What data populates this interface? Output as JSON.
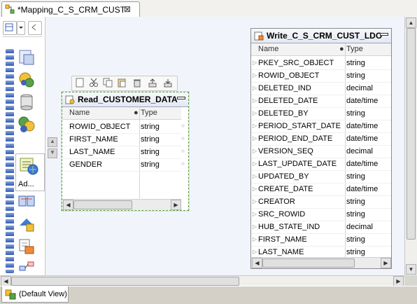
{
  "editor_tab": {
    "title": "*Mapping_C_S_CRM_CUST",
    "close_glyph": "⊠",
    "icon": "mapping-icon"
  },
  "palette": {
    "selected_label": "Ad...",
    "items": [
      "source-icon",
      "transform-icon",
      "database-icon",
      "joiner-icon",
      "address-validator-icon",
      "router-icon",
      "lookup-icon",
      "write-icon",
      "link-icon"
    ],
    "up_glyph": "▲",
    "down_glyph": "▼"
  },
  "float_toolbar": [
    "new-icon",
    "cut-icon",
    "copy-icon",
    "paste-icon",
    "delete-icon",
    "export-icon",
    "import-icon"
  ],
  "read_transform": {
    "title": "Read_CUSTOMER_DATA",
    "col_name": "Name",
    "col_type": "Type",
    "rows": [
      {
        "name": "ROWID_OBJECT",
        "type": "string"
      },
      {
        "name": "FIRST_NAME",
        "type": "string"
      },
      {
        "name": "LAST_NAME",
        "type": "string"
      },
      {
        "name": "GENDER",
        "type": "string"
      }
    ]
  },
  "write_transform": {
    "title": "Write_C_S_CRM_CUST_LDO",
    "col_name": "Name",
    "col_type": "Type",
    "rows": [
      {
        "name": "PKEY_SRC_OBJECT",
        "type": "string"
      },
      {
        "name": "ROWID_OBJECT",
        "type": "string"
      },
      {
        "name": "DELETED_IND",
        "type": "decimal"
      },
      {
        "name": "DELETED_DATE",
        "type": "date/time"
      },
      {
        "name": "DELETED_BY",
        "type": "string"
      },
      {
        "name": "PERIOD_START_DATE",
        "type": "date/time"
      },
      {
        "name": "PERIOD_END_DATE",
        "type": "date/time"
      },
      {
        "name": "VERSION_SEQ",
        "type": "decimal"
      },
      {
        "name": "LAST_UPDATE_DATE",
        "type": "date/time"
      },
      {
        "name": "UPDATED_BY",
        "type": "string"
      },
      {
        "name": "CREATE_DATE",
        "type": "date/time"
      },
      {
        "name": "CREATOR",
        "type": "string"
      },
      {
        "name": "SRC_ROWID",
        "type": "string"
      },
      {
        "name": "HUB_STATE_IND",
        "type": "decimal"
      },
      {
        "name": "FIRST_NAME",
        "type": "string"
      },
      {
        "name": "LAST_NAME",
        "type": "string"
      }
    ]
  },
  "scroll": {
    "left_glyph": "◀",
    "right_glyph": "▶",
    "up_glyph": "▲",
    "down_glyph": "▼"
  },
  "bottom_tab": {
    "label": "(Default View)"
  },
  "colors": {
    "accent": "#3d64b8",
    "selection_border": "#5aa04a"
  }
}
